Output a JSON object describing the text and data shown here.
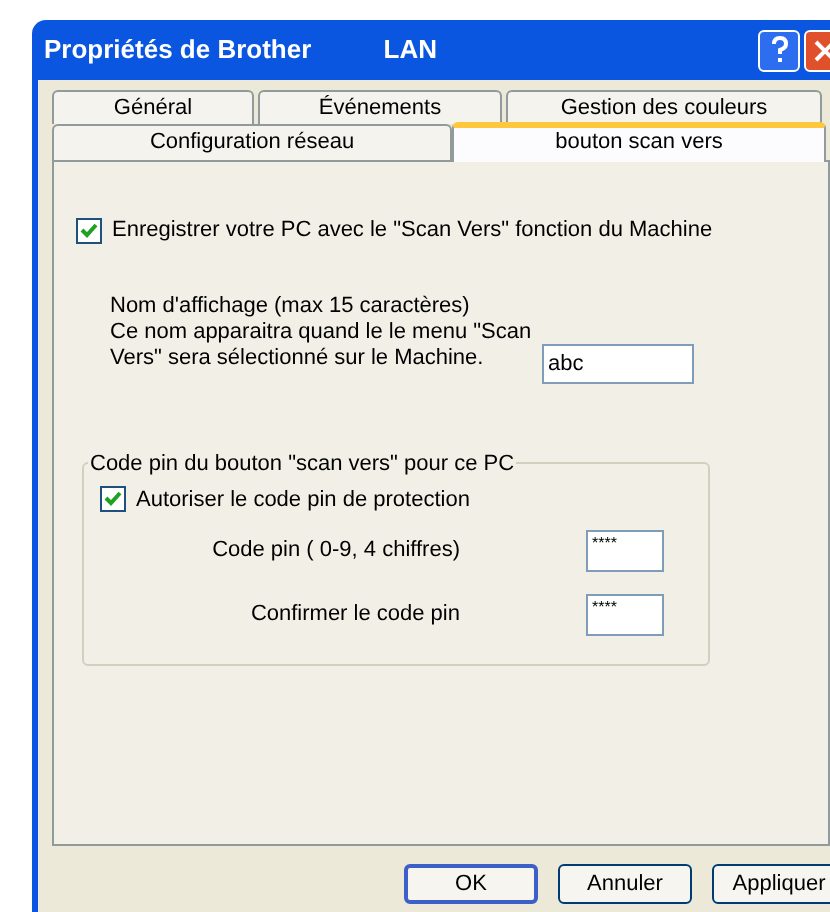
{
  "window": {
    "title": "Propriétés de Brother          LAN"
  },
  "tab_rows": [
    [
      {
        "label": "Général",
        "selected": false
      },
      {
        "label": "Événements",
        "selected": false
      },
      {
        "label": "Gestion des couleurs",
        "selected": false
      }
    ],
    [
      {
        "label": "Configuration réseau",
        "selected": false
      },
      {
        "label": "bouton scan vers",
        "selected": true
      }
    ]
  ],
  "register": {
    "label": "Enregistrer votre PC avec le \"Scan Vers\" fonction du Machine",
    "checked": true
  },
  "display_name": {
    "lines": [
      "Nom d'affichage (max 15 caractères)",
      "Ce nom apparaitra quand le le menu \"Scan",
      "Vers\" sera sélectionné sur le Machine."
    ],
    "value": "abc"
  },
  "pin_group": {
    "title": "Code pin du bouton \"scan vers\" pour ce PC",
    "protect": {
      "label": "Autoriser le code pin de protection",
      "checked": true
    },
    "fields": [
      {
        "label": "Code pin ( 0-9, 4 chiffres)",
        "value": "****"
      },
      {
        "label": "Confirmer le code pin",
        "value": "****"
      }
    ]
  },
  "buttons": [
    {
      "label": "OK",
      "default": true
    },
    {
      "label": "Annuler",
      "default": false
    },
    {
      "label": "Appliquer",
      "default": false
    }
  ]
}
